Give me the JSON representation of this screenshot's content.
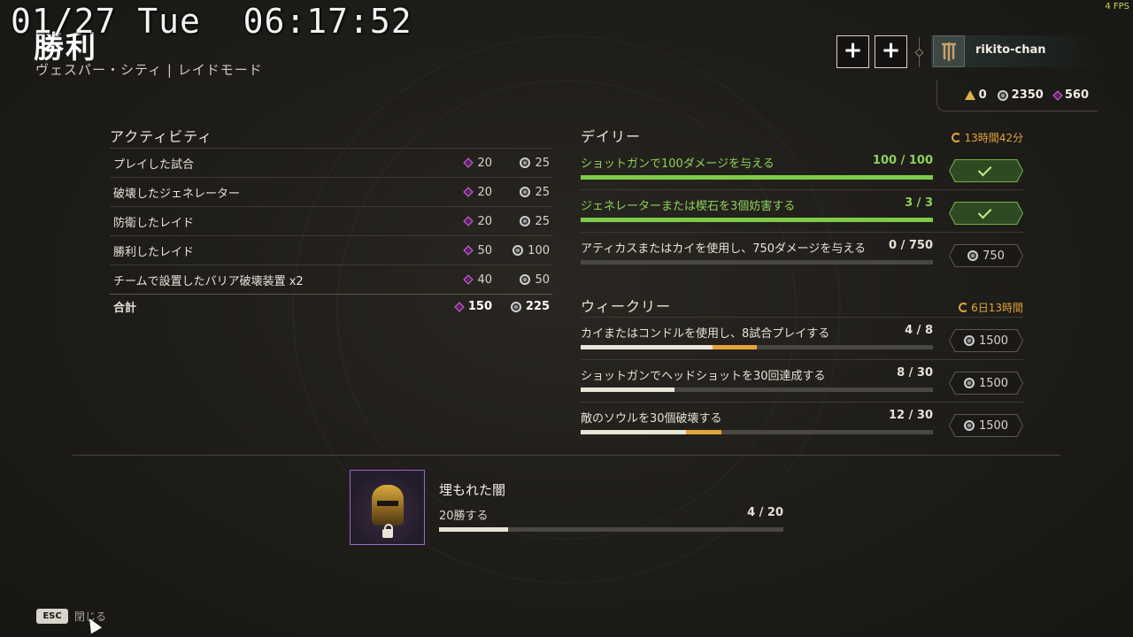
{
  "overlay": {
    "clock": "01/27 Tue  06:17:52",
    "fps": "4 FPS"
  },
  "header": {
    "title": "勝利",
    "subtitle": "ヴェスパー・シティ | レイドモード",
    "plus_label": "+",
    "username": "rikito-chan",
    "currency": {
      "triangle": "0",
      "coins": "2350",
      "gems": "560"
    }
  },
  "activity": {
    "title": "アクティビティ",
    "rows": [
      {
        "label": "プレイした試合",
        "gems": "20",
        "coins": "25"
      },
      {
        "label": "破壊したジェネレーター",
        "gems": "20",
        "coins": "25"
      },
      {
        "label": "防衛したレイド",
        "gems": "20",
        "coins": "25"
      },
      {
        "label": "勝利したレイド",
        "gems": "50",
        "coins": "100"
      },
      {
        "label": "チームで設置したバリア破壊装置 x2",
        "gems": "40",
        "coins": "50"
      }
    ],
    "total": {
      "label": "合計",
      "gems": "150",
      "coins": "225"
    }
  },
  "daily": {
    "title": "デイリー",
    "timer": "13時間42分",
    "quests": [
      {
        "label": "ショットガンで100ダメージを与える",
        "progress": "100 / 100",
        "fraction": 1.0,
        "reward": "",
        "claimed": true
      },
      {
        "label": "ジェネレーターまたは楔石を3個妨害する",
        "progress": "3 / 3",
        "fraction": 1.0,
        "reward": "",
        "claimed": true
      },
      {
        "label": "アティカスまたはカイを使用し、750ダメージを与える",
        "progress": "0 / 750",
        "fraction": 0.0,
        "reward": "750",
        "claimed": false
      }
    ]
  },
  "weekly": {
    "title": "ウィークリー",
    "timer": "6日13時間",
    "quests": [
      {
        "label": "カイまたはコンドルを使用し、8試合プレイする",
        "progress": "4 / 8",
        "fraction": 0.375,
        "gain": 0.125,
        "reward": "1500"
      },
      {
        "label": "ショットガンでヘッドショットを30回達成する",
        "progress": "8 / 30",
        "fraction": 0.267,
        "gain": 0.0,
        "reward": "1500"
      },
      {
        "label": "敵のソウルを30個破壊する",
        "progress": "12 / 30",
        "fraction": 0.3,
        "gain": 0.1,
        "reward": "1500"
      }
    ]
  },
  "challenge": {
    "title": "埋もれた闇",
    "description": "20勝する",
    "progress": "4 / 20",
    "fraction": 0.2
  },
  "footer": {
    "esc_key": "ESC",
    "close_label": "閉じる"
  },
  "colors": {
    "accent_green": "#7ecb4a",
    "accent_orange": "#e3a33a",
    "gem_purple": "#d36bd8"
  }
}
